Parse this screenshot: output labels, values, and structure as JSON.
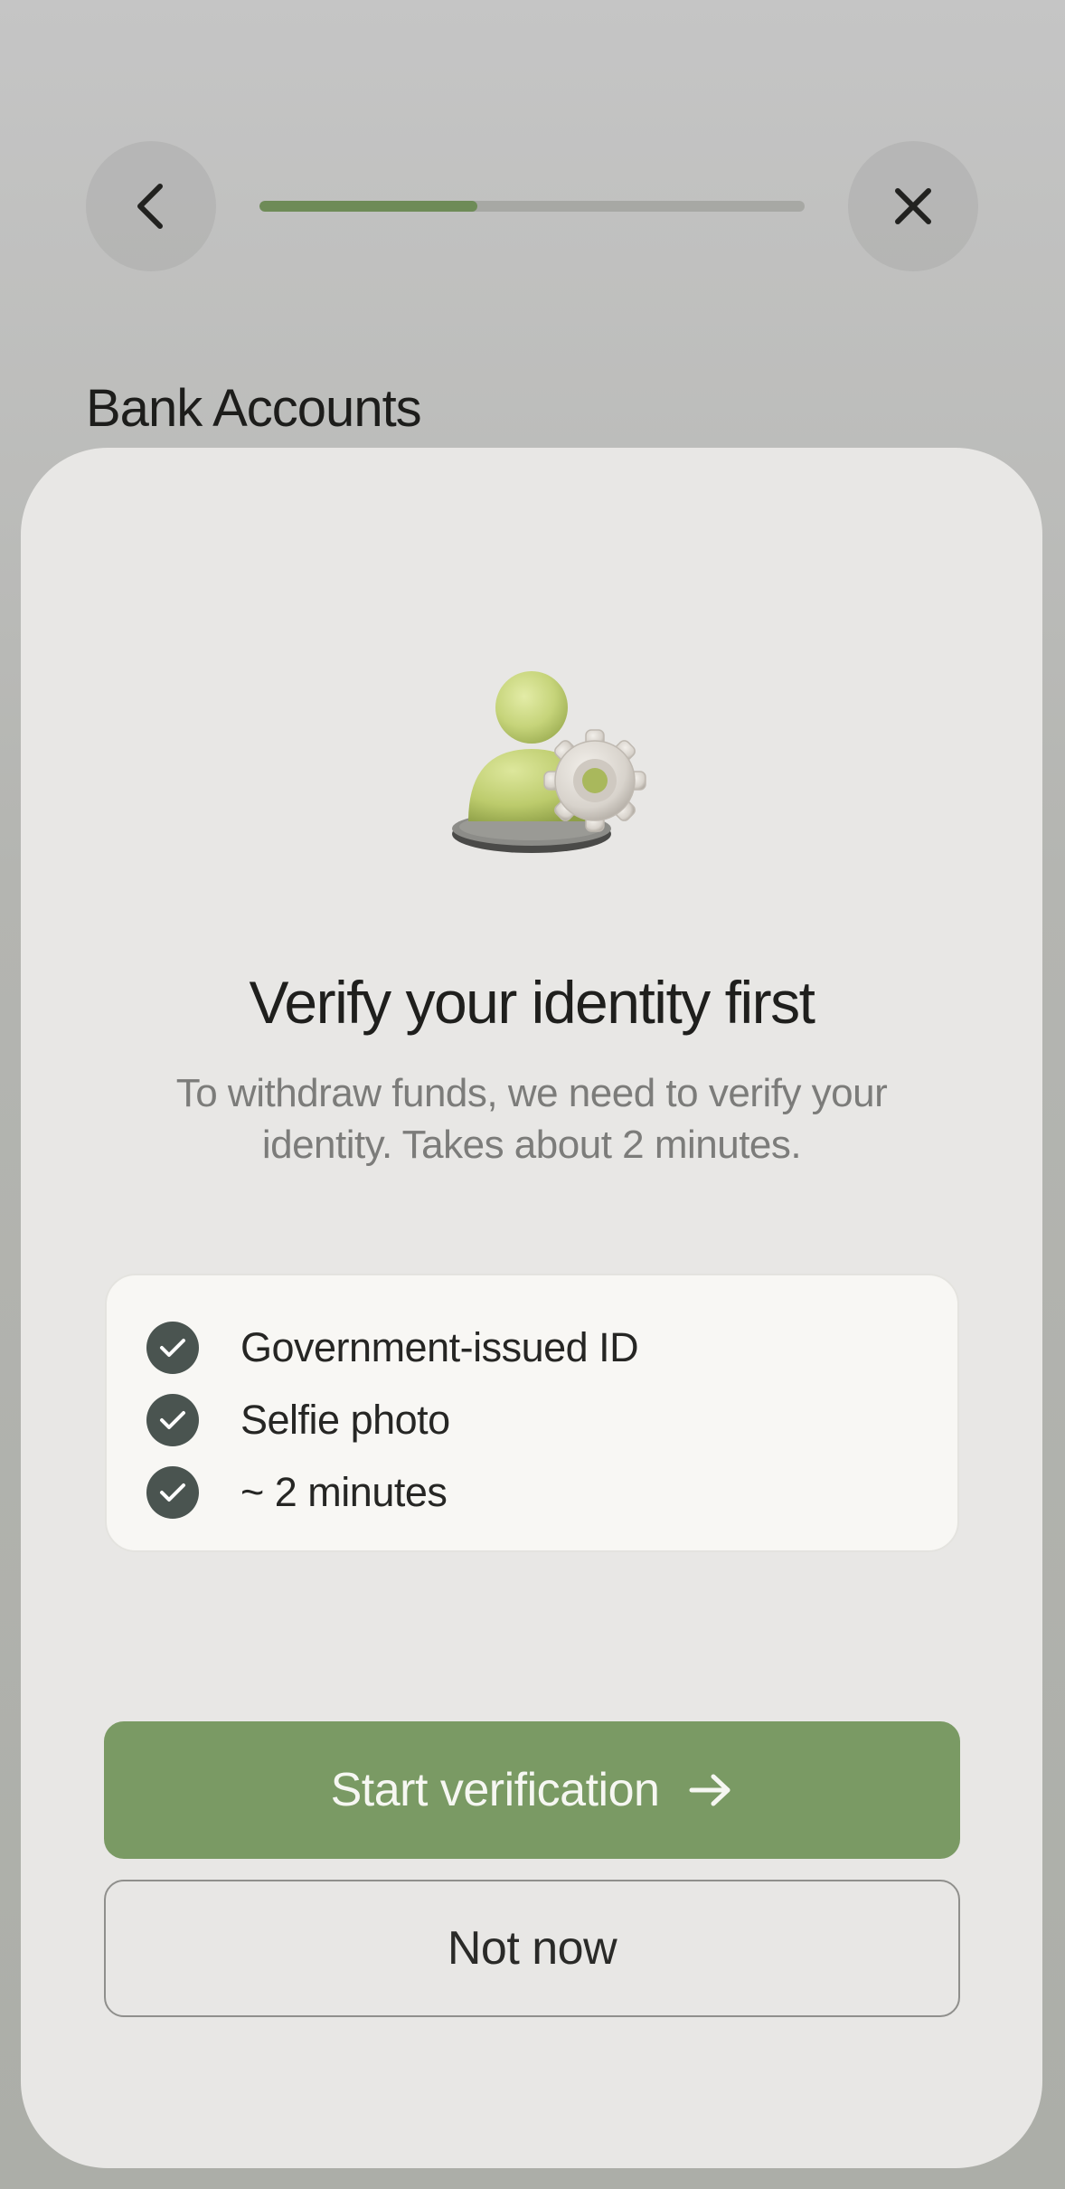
{
  "header": {
    "back_icon": "chevron-left-icon",
    "close_icon": "close-icon",
    "progress_fraction": 0.4
  },
  "page": {
    "title": "Bank Accounts"
  },
  "sheet": {
    "illustration_icon": "user-settings-icon",
    "heading": "Verify your identity first",
    "subtitle": "To withdraw funds, we need to verify your identity. Takes about 2 minutes.",
    "requirements": [
      {
        "label": "Government-issued ID",
        "icon": "check-circle-icon"
      },
      {
        "label": "Selfie photo",
        "icon": "check-circle-icon"
      },
      {
        "label": "~ 2 minutes",
        "icon": "check-circle-icon"
      }
    ],
    "primary_button": {
      "label": "Start verification",
      "icon": "arrow-right-icon"
    },
    "secondary_button": {
      "label": "Not now"
    }
  },
  "colors": {
    "accent": "#7a9a64",
    "progress": "#6e8b57",
    "check_badge": "#4a5450",
    "sheet_bg": "#e8e7e5",
    "card_bg": "#f8f7f4"
  }
}
